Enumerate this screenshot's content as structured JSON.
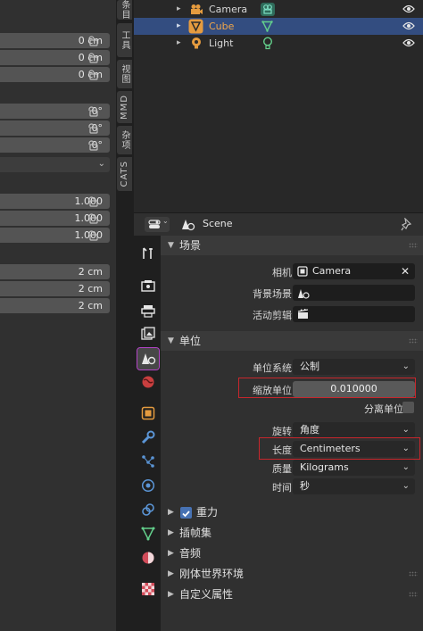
{
  "npanel": {
    "location": [
      "0 cm",
      "0 cm",
      "0 cm"
    ],
    "rotation": [
      "0°",
      "0°",
      "0°"
    ],
    "scale": [
      "1.000",
      "1.000",
      "1.000"
    ],
    "dimensions": [
      "2 cm",
      "2 cm",
      "2 cm"
    ]
  },
  "vtabs": [
    "条目",
    "工具",
    "视图",
    "MMD",
    "杂项",
    "CATS"
  ],
  "outliner": {
    "rows": [
      {
        "label": "Camera",
        "icon": "camera-icon",
        "data_icon": "camera-data-icon"
      },
      {
        "label": "Cube",
        "icon": "mesh-object-icon",
        "data_icon": "mesh-data-icon",
        "selected": true
      },
      {
        "label": "Light",
        "icon": "light-icon",
        "data_icon": "light-data-icon"
      }
    ]
  },
  "props_header": {
    "editor_type_icon": "properties-editor-icon",
    "context_label": "Scene",
    "pin_icon": "pin-icon"
  },
  "prop_tabs": [
    "tool-icon",
    "render-icon",
    "output-icon",
    "view-layer-icon",
    "scene-icon",
    "world-icon",
    "object-icon",
    "modifier-icon",
    "particles-icon",
    "physics-icon",
    "constraints-icon",
    "object-data-icon",
    "material-icon",
    "texture-icon"
  ],
  "scene_panel": {
    "title": "场景",
    "camera_label": "相机",
    "camera_value": "Camera",
    "background_label": "背景场景",
    "clip_label": "活动剪辑"
  },
  "units_panel": {
    "title": "单位",
    "unit_system_label": "单位系统",
    "unit_system_value": "公制",
    "unit_scale_label": "缩放单位",
    "unit_scale_value": "0.010000",
    "separate_units_label": "分离单位",
    "rotation_label": "旋转",
    "rotation_value": "角度",
    "length_label": "长度",
    "length_value": "Centimeters",
    "mass_label": "质量",
    "mass_value": "Kilograms",
    "time_label": "时间",
    "time_value": "秒"
  },
  "collapsed_panels": [
    {
      "title": "重力",
      "checkbox": true
    },
    {
      "title": "插帧集"
    },
    {
      "title": "音频"
    },
    {
      "title": "刚体世界环境"
    },
    {
      "title": "自定义属性"
    }
  ],
  "colors": {
    "selected_row": "#334d80",
    "highlight_box": "#c8262c",
    "active_tab_outline": "#b344c7",
    "checkbox_blue": "#4772b3"
  }
}
